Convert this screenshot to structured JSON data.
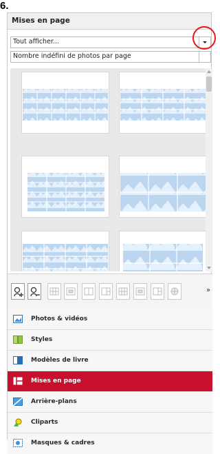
{
  "step_label": "6.",
  "panel": {
    "title": "Mises en page",
    "filter": {
      "selected": "Tout afficher..."
    },
    "photos_per_page": {
      "selected": "Nombre indéfini de photos par page"
    }
  },
  "layout_icons": [
    "person-zoom-in-icon",
    "person-zoom-out-icon",
    "layout-grid-icon",
    "layout-grid-icon",
    "layout-grid-icon",
    "layout-grid-icon",
    "layout-grid-icon",
    "layout-grid-icon",
    "globe-icon"
  ],
  "toolbar": {
    "more_label": "»"
  },
  "categories": [
    {
      "label": "Photos & vidéos",
      "icon": "photo-icon"
    },
    {
      "label": "Styles",
      "icon": "styles-icon"
    },
    {
      "label": "Modèles de livre",
      "icon": "book-template-icon"
    },
    {
      "label": "Mises en page",
      "icon": "layout-icon",
      "active": true
    },
    {
      "label": "Arrière-plans",
      "icon": "background-icon"
    },
    {
      "label": "Cliparts",
      "icon": "clipart-icon"
    },
    {
      "label": "Masques & cadres",
      "icon": "masks-frames-icon"
    }
  ],
  "colors": {
    "accent": "#c8102e",
    "highlight_circle": "#e8141b",
    "placeholder_blue": "#b9d5ee"
  }
}
